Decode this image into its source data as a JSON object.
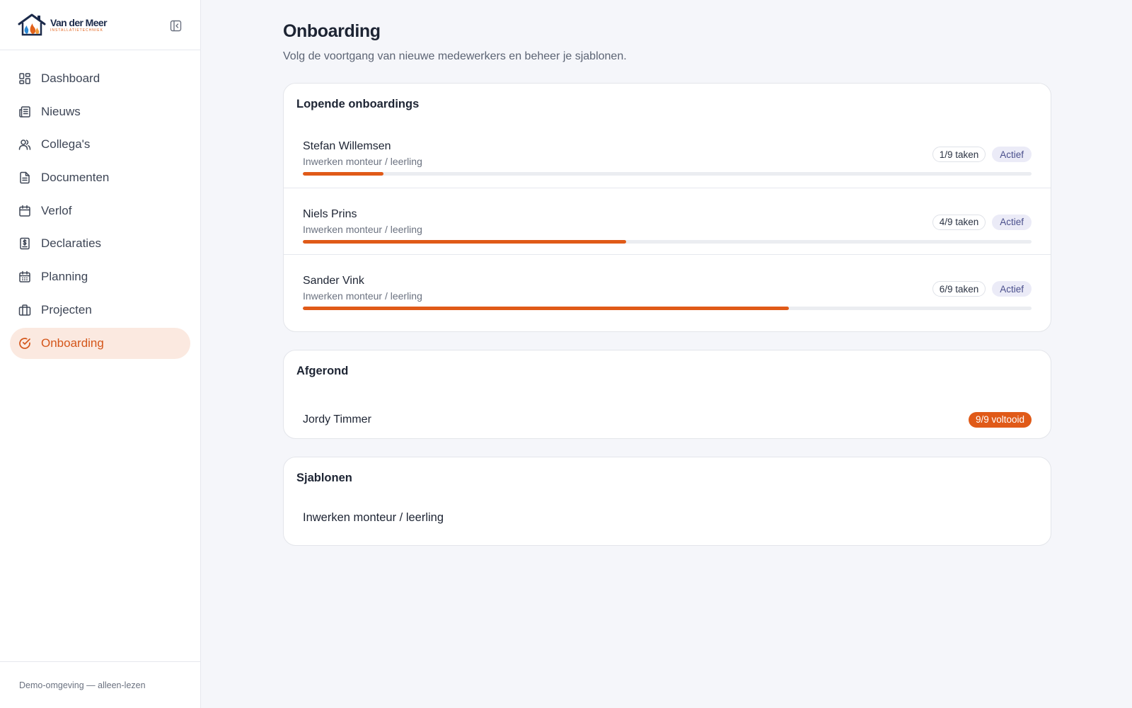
{
  "brand": {
    "name": "Van der Meer",
    "subtitle": "INSTALLATIETECHNIEK",
    "colors": {
      "house": "#1b2a4a",
      "flame": "#e2621b",
      "drop": "#2b8ad6"
    }
  },
  "sidebar": {
    "collapse_icon": "sidebar-collapse-icon",
    "items": [
      {
        "label": "Dashboard",
        "icon": "dashboard-icon",
        "active": false
      },
      {
        "label": "Nieuws",
        "icon": "newspaper-icon",
        "active": false
      },
      {
        "label": "Collega's",
        "icon": "users-icon",
        "active": false
      },
      {
        "label": "Documenten",
        "icon": "document-icon",
        "active": false
      },
      {
        "label": "Verlof",
        "icon": "calendar-icon",
        "active": false
      },
      {
        "label": "Declaraties",
        "icon": "receipt-icon",
        "active": false
      },
      {
        "label": "Planning",
        "icon": "calendar-grid-icon",
        "active": false
      },
      {
        "label": "Projecten",
        "icon": "briefcase-icon",
        "active": false
      },
      {
        "label": "Onboarding",
        "icon": "check-circle-icon",
        "active": true
      }
    ],
    "footer": "Demo-omgeving — alleen-lezen"
  },
  "page": {
    "title": "Onboarding",
    "subtitle": "Volg de voortgang van nieuwe medewerkers en beheer je sjablonen."
  },
  "running": {
    "title": "Lopende onboardings",
    "rows": [
      {
        "name": "Stefan Willemsen",
        "template": "Inwerken monteur / leerling",
        "tasks": "1/9 taken",
        "status": "Actief",
        "progress": 0.111
      },
      {
        "name": "Niels Prins",
        "template": "Inwerken monteur / leerling",
        "tasks": "4/9 taken",
        "status": "Actief",
        "progress": 0.444
      },
      {
        "name": "Sander Vink",
        "template": "Inwerken monteur / leerling",
        "tasks": "6/9 taken",
        "status": "Actief",
        "progress": 0.667
      }
    ]
  },
  "completed": {
    "title": "Afgerond",
    "rows": [
      {
        "name": "Jordy Timmer",
        "badge": "9/9 voltooid"
      }
    ]
  },
  "templates": {
    "title": "Sjablonen",
    "rows": [
      {
        "name": "Inwerken monteur / leerling"
      }
    ]
  },
  "colors": {
    "accent": "#e05a18",
    "active_bg": "#fbe9e0",
    "status_bg": "#ebebf7",
    "status_text": "#4a4f8c"
  }
}
